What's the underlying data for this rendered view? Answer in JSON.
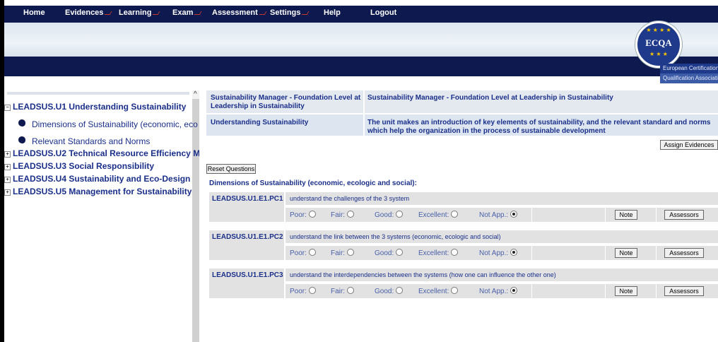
{
  "nav": {
    "items": [
      {
        "label": "Home",
        "caret": false
      },
      {
        "label": "Evidences",
        "caret": true
      },
      {
        "label": "Learning",
        "caret": true
      },
      {
        "label": "Exam",
        "caret": true
      },
      {
        "label": "Assessment",
        "caret": true
      },
      {
        "label": "Settings",
        "caret": true
      },
      {
        "label": "Help",
        "caret": false
      },
      {
        "label": "Logout",
        "caret": false
      }
    ]
  },
  "logo": {
    "text": "ECQA",
    "org_line1": "European Certification",
    "org_line2": "Qualification Associatio"
  },
  "sidebar": {
    "units": [
      {
        "label": "LEADSUS.U1 Understanding Sustainability",
        "expander": "−",
        "expanded": true
      },
      {
        "label": "LEADSUS.U2 Technical Resource Efficiency M",
        "expander": "+"
      },
      {
        "label": "LEADSUS.U3 Social Responsibility",
        "expander": "+"
      },
      {
        "label": "LEADSUS.U4 Sustainability and Eco-Design",
        "expander": "+"
      },
      {
        "label": "LEADSUS.U5 Management for Sustainability",
        "expander": "+"
      }
    ],
    "subitems": [
      {
        "label": "Dimensions of Sustainability (economic, eco"
      },
      {
        "label": "Relevant Standards and Norms"
      }
    ]
  },
  "header": {
    "row1_left": "Sustainability Manager - Foundation Level at Leadership in Sustainability",
    "row1_right": "Sustainability Manager - Foundation Level at Leadership in Sustainability",
    "row2_left": "Understanding Sustainability",
    "row2_right": "The unit makes an introduction of key elements of sustainability, and the relevant standard and norms which help the organization in the process of sustainable development"
  },
  "buttons": {
    "assign_evidences": "Assign Evidences",
    "reset_questions": "Reset Questions",
    "note": "Note",
    "assessors": "Assessors"
  },
  "section_title": "Dimensions of Sustainability (economic, ecologic and social):",
  "options": {
    "poor": "Poor:",
    "fair": "Fair:",
    "good": "Good:",
    "excellent": "Excellent:",
    "not_app": "Not App.:"
  },
  "criteria": [
    {
      "code": "LEADSUS.U1.E1.PC1",
      "description": "understand the challenges of the 3 system",
      "selected": "not_app"
    },
    {
      "code": "LEADSUS.U1.E1.PC2",
      "description": "understand the link between the 3 systems (economic, ecologic and social)",
      "selected": "not_app"
    },
    {
      "code": "LEADSUS.U1.E1.PC3",
      "description": "understand the interdependencies between the systems (how one can influence the other one)",
      "selected": "not_app"
    }
  ]
}
